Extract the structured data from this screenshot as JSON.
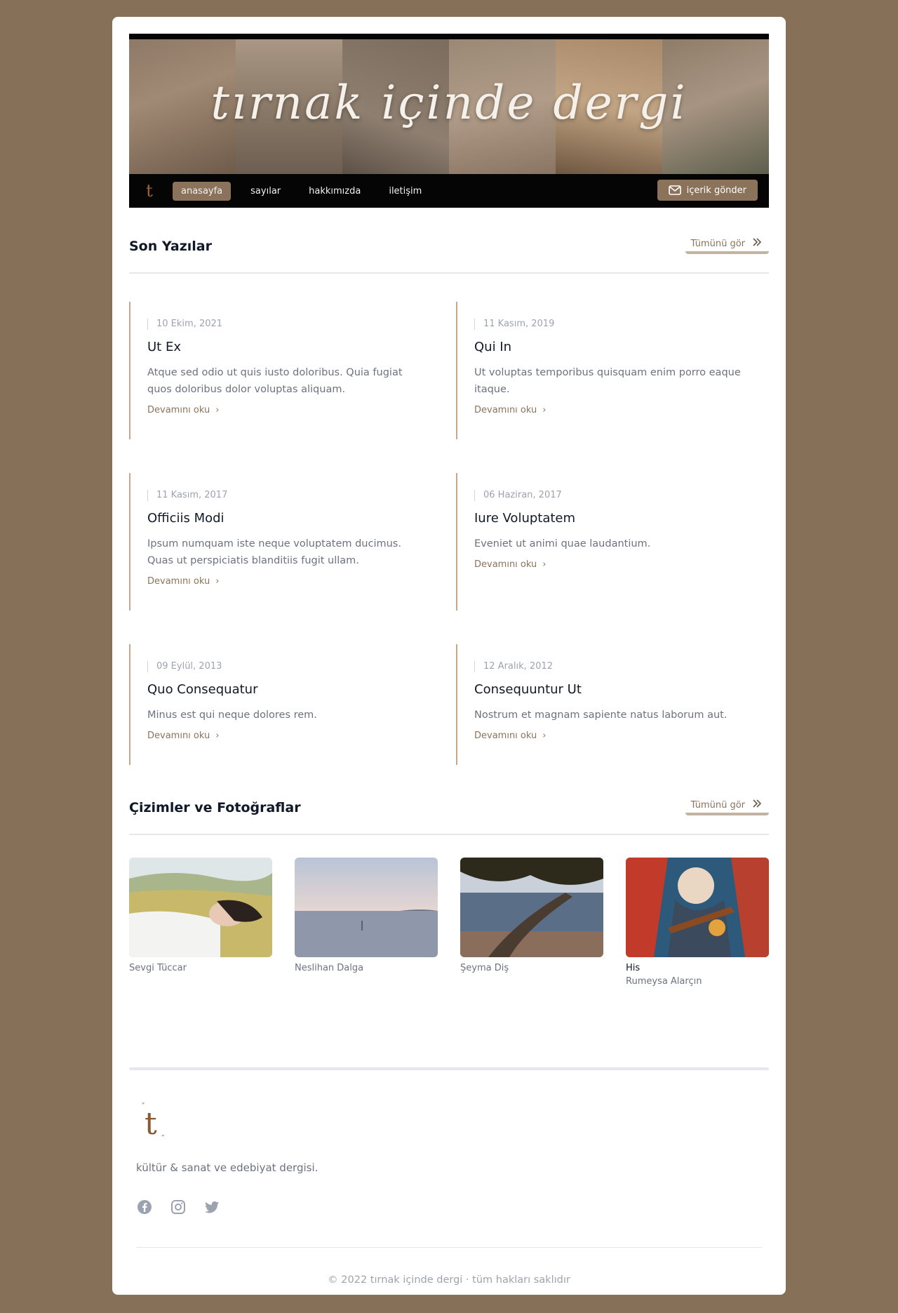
{
  "banner": {
    "title": "tırnak içinde dergi"
  },
  "nav": {
    "logo_letter": "t",
    "items": [
      {
        "label": "anasayfa",
        "active": true
      },
      {
        "label": "sayılar"
      },
      {
        "label": "hakkımızda"
      },
      {
        "label": "iletişim"
      }
    ],
    "submit_label": "içerik gönder"
  },
  "posts_section": {
    "title": "Son Yazılar",
    "see_all": "Tümünü gör",
    "posts": [
      {
        "date": "10 Ekim, 2021",
        "title": "Ut Ex",
        "excerpt": "Atque sed odio ut quis iusto doloribus. Quia fugiat quos doloribus dolor voluptas aliquam.",
        "more": "Devamını oku"
      },
      {
        "date": "11 Kasım, 2019",
        "title": "Qui In",
        "excerpt": "Ut voluptas temporibus quisquam enim porro eaque itaque.",
        "more": "Devamını oku"
      },
      {
        "date": "11 Kasım, 2017",
        "title": "Officiis Modi",
        "excerpt": "Ipsum numquam iste neque voluptatem ducimus. Quas ut perspiciatis blanditiis fugit ullam.",
        "more": "Devamını oku"
      },
      {
        "date": "06 Haziran, 2017",
        "title": "Iure Voluptatem",
        "excerpt": "Eveniet ut animi quae laudantium.",
        "more": "Devamını oku"
      },
      {
        "date": "09 Eylül, 2013",
        "title": "Quo Consequatur",
        "excerpt": "Minus est qui neque dolores rem.",
        "more": "Devamını oku"
      },
      {
        "date": "12 Aralık, 2012",
        "title": "Consequuntur Ut",
        "excerpt": "Nostrum et magnam sapiente natus laborum aut.",
        "more": "Devamını oku"
      }
    ]
  },
  "gallery_section": {
    "title": "Çizimler ve Fotoğraflar",
    "see_all": "Tümünü gör",
    "items": [
      {
        "title": "",
        "author": "Sevgi Tüccar"
      },
      {
        "title": "",
        "author": "Neslihan Dalga"
      },
      {
        "title": "",
        "author": "Şeyma Diş"
      },
      {
        "title": "His",
        "author": "Rumeysa Alarçın"
      }
    ]
  },
  "footer": {
    "logo_letter": "t",
    "tagline": "kültür & sanat ve edebiyat dergisi.",
    "social": [
      "facebook-icon",
      "instagram-icon",
      "twitter-icon"
    ],
    "copyright": "© 2022 tırnak içinde dergi · tüm hakları saklıdır"
  },
  "colors": {
    "background": "#877058",
    "accent": "#8b735b",
    "nav_bg": "#050505"
  }
}
